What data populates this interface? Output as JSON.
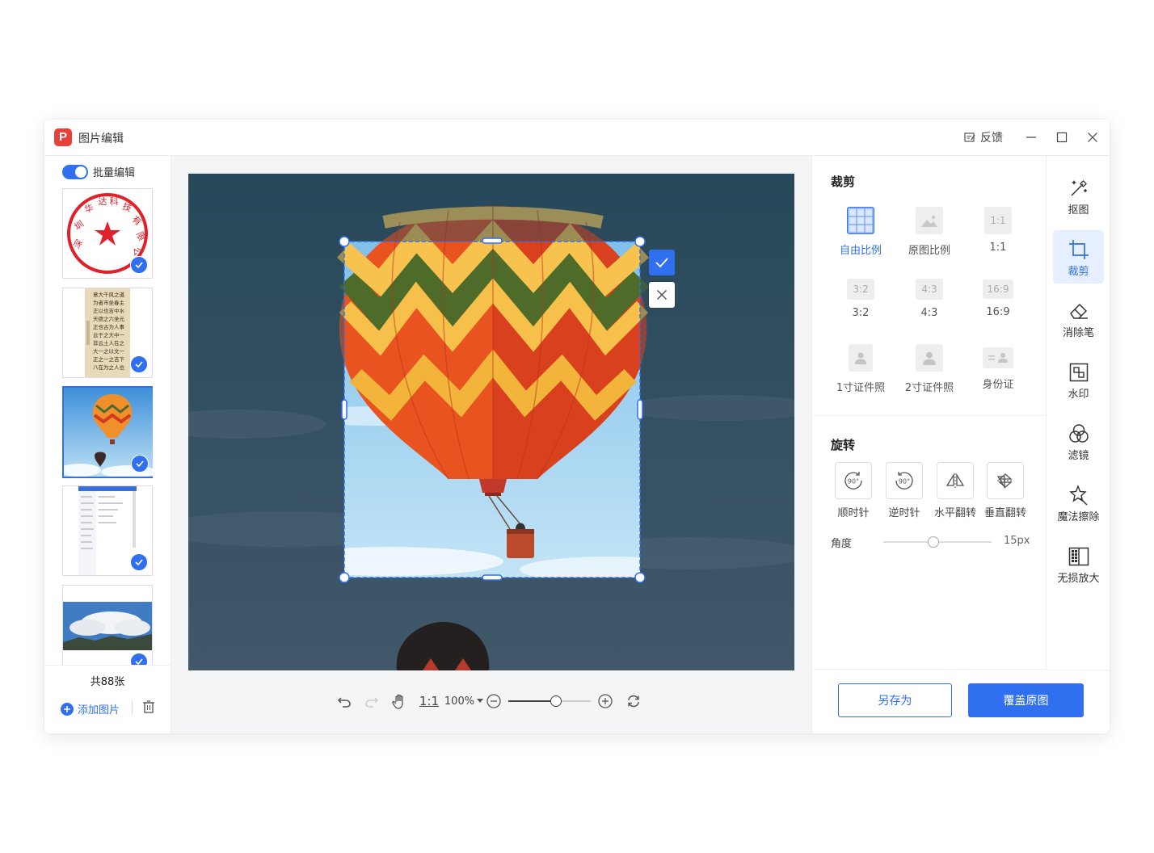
{
  "window": {
    "title": "图片编辑",
    "feedback_label": "反馈"
  },
  "left": {
    "batch_label": "批量编辑",
    "batch_on": true,
    "thumbnails": [
      {
        "name": "seal",
        "selected": false,
        "checked": true
      },
      {
        "name": "calligraphy",
        "selected": false,
        "checked": true
      },
      {
        "name": "balloon",
        "selected": true,
        "checked": true
      },
      {
        "name": "screenshot",
        "selected": false,
        "checked": true
      },
      {
        "name": "clouds",
        "selected": false,
        "checked": true
      }
    ],
    "count_label": "共88张",
    "add_label": "添加图片"
  },
  "toolbar": {
    "one_to_one": "1:1",
    "zoom": "100%",
    "zoom_fraction": 0.58
  },
  "panel": {
    "crop_title": "裁剪",
    "ratios": [
      {
        "label": "自由比例",
        "icon": "grid-icon",
        "active": true
      },
      {
        "label": "原图比例",
        "icon": "image-icon",
        "active": false
      },
      {
        "label": "1:1",
        "icon_text": "1:1",
        "active": false
      },
      {
        "label": "3:2",
        "icon_text": "3:2",
        "active": false
      },
      {
        "label": "4:3",
        "icon_text": "4:3",
        "active": false
      },
      {
        "label": "16:9",
        "icon_text": "16:9",
        "active": false
      },
      {
        "label": "1寸证件照",
        "icon": "person-icon",
        "active": false
      },
      {
        "label": "2寸证件照",
        "icon": "person-icon",
        "active": false
      },
      {
        "label": "身份证",
        "icon": "id-card-icon",
        "active": false
      }
    ],
    "rotate_title": "旋转",
    "rotations": [
      {
        "label": "顺时针",
        "icon_text": "90°"
      },
      {
        "label": "逆时针",
        "icon_text": "90°"
      },
      {
        "label": "水平翻转"
      },
      {
        "label": "垂直翻转"
      }
    ],
    "angle_label": "角度",
    "angle_value": "15px",
    "angle_fraction": 0.46,
    "save_as": "另存为",
    "overwrite": "覆盖原图"
  },
  "tools": [
    {
      "label": "抠图",
      "icon": "magic-wand-icon",
      "active": false
    },
    {
      "label": "裁剪",
      "icon": "crop-icon",
      "active": true
    },
    {
      "label": "消除笔",
      "icon": "eraser-icon",
      "active": false
    },
    {
      "label": "水印",
      "icon": "watermark-icon",
      "active": false
    },
    {
      "label": "滤镜",
      "icon": "filter-icon",
      "active": false
    },
    {
      "label": "魔法擦除",
      "icon": "magic-erase-icon",
      "active": false
    },
    {
      "label": "无损放大",
      "icon": "upscale-icon",
      "active": false
    }
  ],
  "thumb_seal_text": "深圳华达科技有限公司",
  "colors": {
    "accent": "#2f6ff0",
    "sky_dark": "#2d4a5a",
    "sky_light": "#9fd3ef"
  }
}
